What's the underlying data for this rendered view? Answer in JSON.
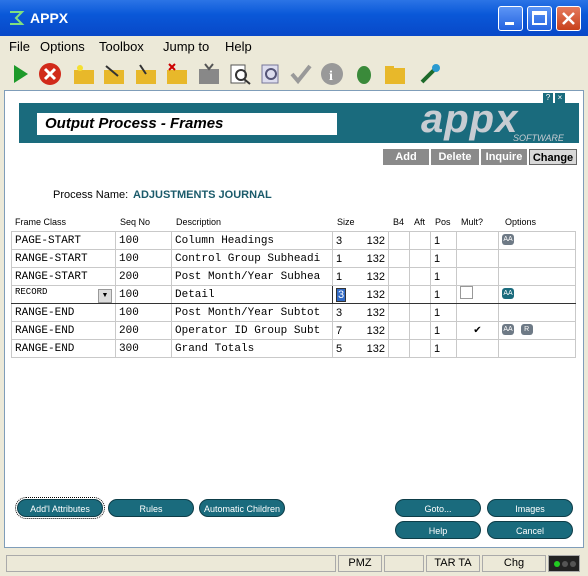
{
  "app": {
    "title": "APPX"
  },
  "menu": [
    "File",
    "Options",
    "Toolbox",
    "Jump to",
    "Help"
  ],
  "toolbar_icons": [
    "run-icon",
    "stop-icon",
    "folder-star-icon",
    "edit-icon",
    "folder-edit-icon",
    "folder-delete-icon",
    "tv-icon",
    "inspect-icon",
    "search-doc-icon",
    "check-icon",
    "info-icon",
    "bug-icon",
    "folder-icon",
    "settings-icon"
  ],
  "header": {
    "title": "Output Process - Frames",
    "logo": "appx",
    "logo_sub": "SOFTWARE"
  },
  "modes": {
    "add": "Add",
    "delete": "Delete",
    "inquire": "Inquire",
    "change": "Change"
  },
  "process": {
    "label": "Process Name:",
    "value": "ADJUSTMENTS JOURNAL"
  },
  "columns": {
    "frame_class": "Frame Class",
    "seq": "Seq No",
    "desc": "Description",
    "size": "Size",
    "b4": "B4",
    "aft": "Aft",
    "pos": "Pos",
    "mult": "Mult?",
    "options": "Options"
  },
  "rows": [
    {
      "cls": "PAGE-START",
      "seq": "100",
      "desc": "Column Headings",
      "size": "3",
      "width": "132",
      "pos": "1",
      "opt": "AA"
    },
    {
      "cls": "RANGE-START",
      "seq": "100",
      "desc": "Control Group Subheadi",
      "size": "1",
      "width": "132",
      "pos": "1",
      "opt": ""
    },
    {
      "cls": "RANGE-START",
      "seq": "200",
      "desc": "Post Month/Year Subhea",
      "size": "1",
      "width": "132",
      "pos": "1",
      "opt": ""
    },
    {
      "cls": "RECORD",
      "seq": "100",
      "desc": "Detail",
      "size": "3",
      "width": "132",
      "pos": "1",
      "opt": "AA"
    },
    {
      "cls": "RANGE-END",
      "seq": "100",
      "desc": "Post Month/Year Subtot",
      "size": "3",
      "width": "132",
      "pos": "1",
      "opt": ""
    },
    {
      "cls": "RANGE-END",
      "seq": "200",
      "desc": "Operator ID Group Subt",
      "size": "7",
      "width": "132",
      "pos": "1",
      "opt": "AA R"
    },
    {
      "cls": "RANGE-END",
      "seq": "300",
      "desc": "Grand Totals",
      "size": "5",
      "width": "132",
      "pos": "1",
      "opt": ""
    }
  ],
  "buttons": {
    "attributes": "Add'l Attributes",
    "rules": "Rules",
    "children": "Automatic Children",
    "goto": "Goto...",
    "images": "Images",
    "help": "Help",
    "cancel": "Cancel"
  },
  "status": {
    "pmz": "PMZ",
    "tar": "TAR TA",
    "chg": "Chg"
  }
}
